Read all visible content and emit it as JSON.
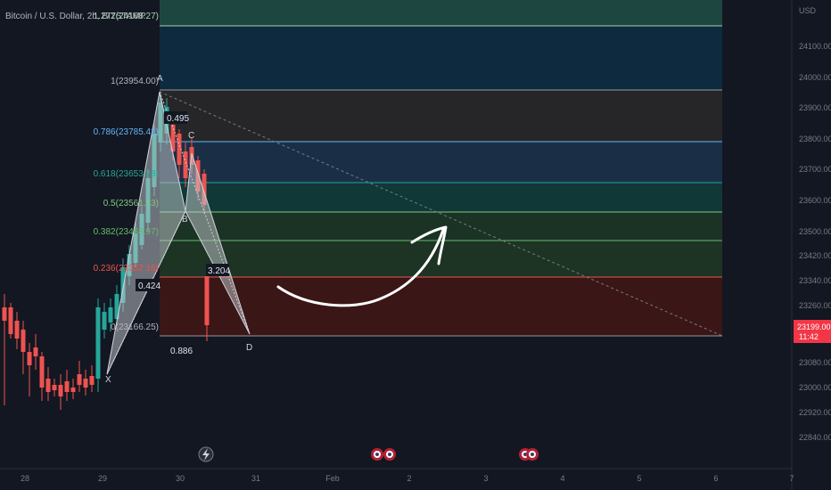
{
  "title": "Bitcoin / U.S. Dollar, 2h, BITSTAMP",
  "currency": "USD",
  "price_ticks": [
    "24100.00",
    "24000.00",
    "23900.00",
    "23800.00",
    "23700.00",
    "23600.00",
    "23500.00",
    "23420.00",
    "23340.00",
    "23260.00",
    "23080.00",
    "23000.00",
    "22920.00",
    "22840.00"
  ],
  "time_ticks": [
    "28",
    "29",
    "30",
    "31",
    "Feb",
    "2",
    "3",
    "4",
    "5",
    "6",
    "7"
  ],
  "current_price": {
    "value": "23199.00",
    "countdown": "11:42",
    "color": "#f23645"
  },
  "fib_levels": [
    {
      "label": "1.272(24168.27)",
      "color": "#a5d6a7"
    },
    {
      "label": "1(23954.00)",
      "color": "#b2b5be"
    },
    {
      "label": "0.786(23785.42)",
      "color": "#64b5f6"
    },
    {
      "label": "0.618(23653.28)",
      "color": "#26a69a"
    },
    {
      "label": "0.5(23561.13)",
      "color": "#81c784"
    },
    {
      "label": "0.382(23468.97)",
      "color": "#66bb6a"
    },
    {
      "label": "0.236(23352.16)",
      "color": "#ef5350"
    },
    {
      "label": "0(23166.25)",
      "color": "#b2b5be"
    }
  ],
  "pattern_points": {
    "x": "X",
    "a": "A",
    "b": "B",
    "c": "C",
    "d": "D"
  },
  "ratios": {
    "xab": "0.424",
    "abc": "0.495",
    "bcd": "3.204",
    "xad": "0.886"
  },
  "colors": {
    "bull": "#26a69a",
    "bear": "#ef5350",
    "background": "#131722"
  }
}
